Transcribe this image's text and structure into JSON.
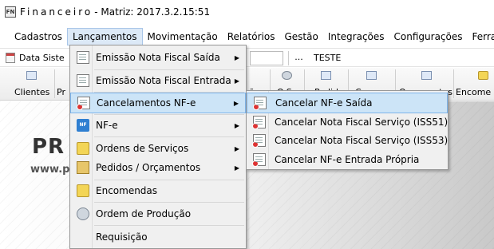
{
  "titlebar": {
    "app_icon_text": "FN",
    "app_name": "Financeiro",
    "rest": " - Matriz: 2017.3.2.15:51"
  },
  "menubar": {
    "items": [
      {
        "label": "Cadastros"
      },
      {
        "label": "Lançamentos"
      },
      {
        "label": "Movimentação"
      },
      {
        "label": "Relatórios"
      },
      {
        "label": "Gestão"
      },
      {
        "label": "Integrações"
      },
      {
        "label": "Configurações"
      },
      {
        "label": "Ferrame"
      }
    ]
  },
  "datarow": {
    "label": "Data Siste",
    "ellipsis": "...",
    "company": "TESTE"
  },
  "toolbar": {
    "buttons": [
      {
        "label": "Clientes"
      },
      {
        "label": "Pr"
      },
      {
        "label": "ões"
      },
      {
        "label": "O.S."
      },
      {
        "label": "Pedidos"
      },
      {
        "label": "Compras"
      },
      {
        "label": "Orçamentos"
      },
      {
        "label": "Encome"
      }
    ]
  },
  "background": {
    "logo_big": "PR",
    "logo_small": "www.p"
  },
  "lancamentos_menu": {
    "items": [
      {
        "label": "Emissão Nota Fiscal Saída",
        "icon": "nota-fiscal-saida-icon",
        "submenu": true
      },
      {
        "label": "Emissão Nota Fiscal Entrada",
        "icon": "nota-fiscal-entrada-icon",
        "submenu": true
      },
      {
        "label": "Cancelamentos NF-e",
        "icon": "cancel-document-icon",
        "submenu": true,
        "highlighted": true
      },
      {
        "label": "NF-e",
        "icon": "nfe-icon",
        "submenu": true
      },
      {
        "label": "Ordens de Serviços",
        "icon": "service-order-icon",
        "submenu": true
      },
      {
        "label": "Pedidos / Orçamentos",
        "icon": "orders-icon",
        "submenu": true
      },
      {
        "label": "Encomendas",
        "icon": "package-icon",
        "submenu": false
      },
      {
        "label": "Ordem de Produção",
        "icon": "production-icon",
        "submenu": false
      },
      {
        "label": "Requisição",
        "icon": "",
        "submenu": false
      }
    ]
  },
  "cancelamentos_submenu": {
    "items": [
      {
        "label": "Cancelar NF-e Saída",
        "icon": "cancel-document-icon",
        "highlighted": true
      },
      {
        "label": "Cancelar Nota Fiscal Serviço (ISS51)",
        "icon": "cancel-document-icon"
      },
      {
        "label": "Cancelar Nota Fiscal Serviço (ISS53)",
        "icon": "cancel-document-icon"
      },
      {
        "label": "Cancelar NF-e Entrada Própria",
        "icon": "cancel-document-icon"
      }
    ]
  },
  "colors": {
    "highlight_bg": "#cce4f7",
    "highlight_border": "#7eb4ea",
    "menu_bg": "#f0f0f0"
  }
}
